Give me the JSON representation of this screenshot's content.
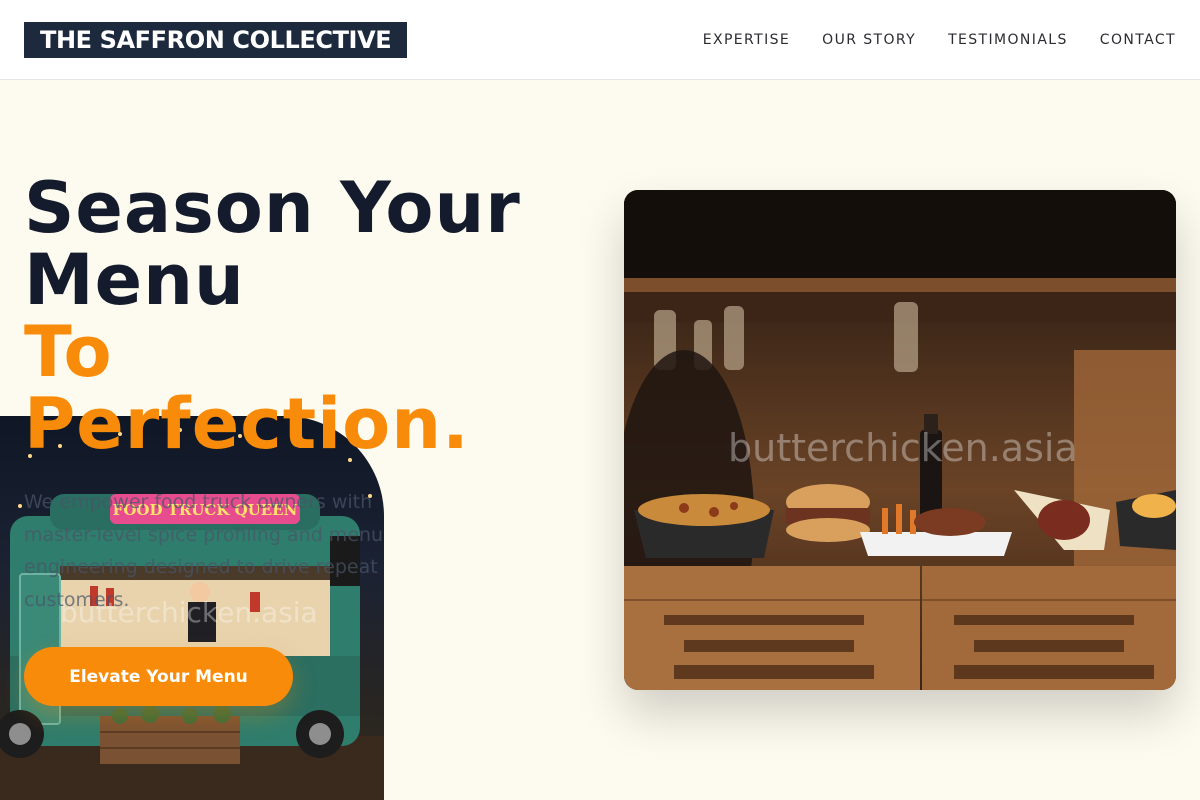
{
  "header": {
    "brand": "THE SAFFRON COLLECTIVE",
    "nav": [
      "EXPERTISE",
      "OUR STORY",
      "TESTIMONIALS",
      "CONTACT"
    ]
  },
  "hero": {
    "headline_line1": "Season Your",
    "headline_line2": "Menu",
    "headline_line3": "To",
    "headline_line4": "Perfection.",
    "intro": "We empower food truck owners with master-level spice profiling and menu engineering designed to drive repeat customers.",
    "cta_label": "Elevate Your Menu",
    "truck_sign": "FOOD TRUCK QUEEN",
    "watermark": "butterchicken.asia"
  },
  "colors": {
    "brand_navy": "#1d2a3d",
    "accent_orange": "#f98b0a",
    "background": "#fdfbef"
  }
}
